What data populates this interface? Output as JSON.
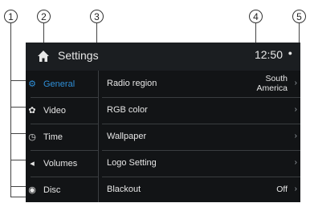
{
  "callouts": [
    "1",
    "2",
    "3",
    "4",
    "5"
  ],
  "header": {
    "title": "Settings",
    "time": "12:50"
  },
  "left_menu": [
    {
      "label": "General",
      "icon": "gear-icon",
      "active": true
    },
    {
      "label": "Video",
      "icon": "film-reel-icon",
      "active": false
    },
    {
      "label": "Time",
      "icon": "clock-icon",
      "active": false
    },
    {
      "label": "Volumes",
      "icon": "speaker-icon",
      "active": false
    },
    {
      "label": "Disc",
      "icon": "disc-icon",
      "active": false
    }
  ],
  "settings_rows": [
    {
      "label": "Radio region",
      "value_line1": "South",
      "value_line2": "America"
    },
    {
      "label": "RGB color",
      "value_line1": "",
      "value_line2": ""
    },
    {
      "label": "Wallpaper",
      "value_line1": "",
      "value_line2": ""
    },
    {
      "label": "Logo Setting",
      "value_line1": "",
      "value_line2": ""
    },
    {
      "label": "Blackout",
      "value_line1": "Off",
      "value_line2": ""
    }
  ],
  "colors": {
    "accent": "#2f8fd8",
    "screen_bg": "#121416",
    "statusbar_bg": "#1b1e21",
    "text": "#e6e6e6"
  }
}
